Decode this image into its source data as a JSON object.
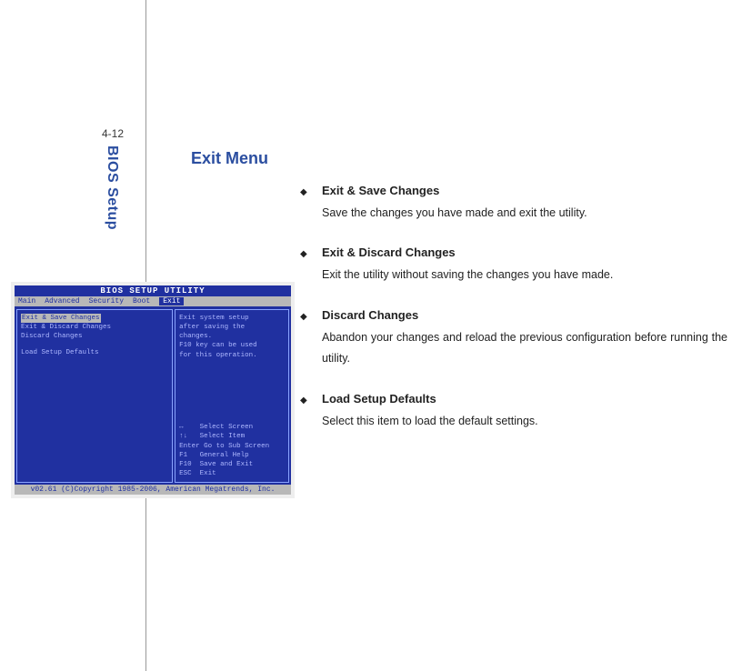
{
  "page_number": "4-12",
  "side_label": "BIOS Setup",
  "title": "Exit Menu",
  "items": [
    {
      "title": "Exit & Save Changes",
      "desc": "Save the changes you have made and exit the utility."
    },
    {
      "title": "Exit & Discard Changes",
      "desc": "Exit the utility without saving the changes you have made."
    },
    {
      "title": "Discard Changes",
      "desc": "Abandon your changes and reload the previous configuration before running the utility."
    },
    {
      "title": "Load Setup Defaults",
      "desc": "Select this item to load the default settings."
    }
  ],
  "bullet": "◆",
  "bios": {
    "titlebar": "BIOS SETUP UTILITY",
    "tabs": [
      "Main",
      "Advanced",
      "Security",
      "Boot",
      "Exit"
    ],
    "selected_tab": "Exit",
    "left_items_highlight": "Exit & Save Changes",
    "left_items": [
      "Exit & Discard Changes",
      "Discard Changes"
    ],
    "left_items2": [
      "Load Setup Defaults"
    ],
    "help": [
      "Exit system setup",
      "after saving the",
      "changes.",
      "",
      "F10 key can be used",
      "for this operation."
    ],
    "keys": [
      "↔    Select Screen",
      "↑↓   Select Item",
      "Enter Go to Sub Screen",
      "F1   General Help",
      "F10  Save and Exit",
      "ESC  Exit"
    ],
    "footer": "v02.61 (C)Copyright 1985-2006, American Megatrends, Inc."
  }
}
